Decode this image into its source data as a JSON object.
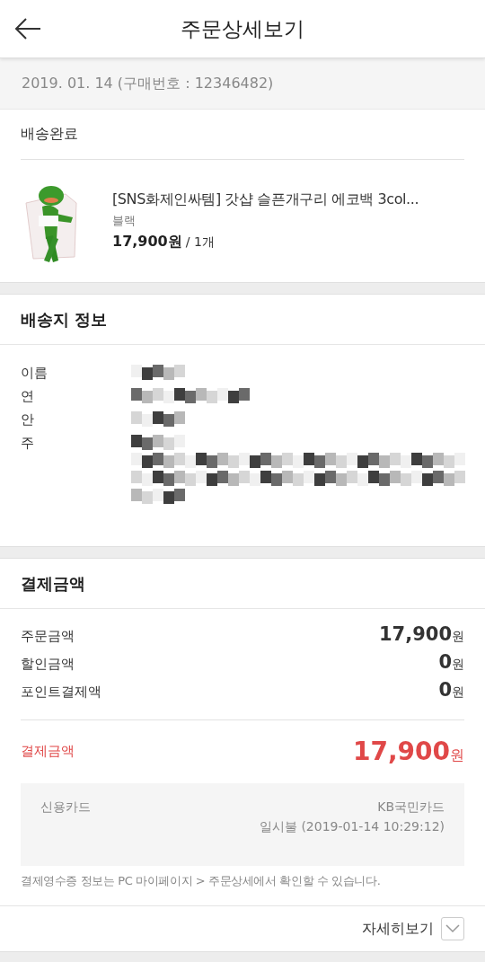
{
  "header": {
    "title": "주문상세보기"
  },
  "order": {
    "date": "2019. 01. 14",
    "number_label": "(구매번호 : 12346482)"
  },
  "shipment": {
    "status": "배송완료",
    "product": {
      "kind": "picture",
      "name": "[SNS화제인싸템] 갓샵 슬픈개구리 에코백 3col...",
      "option": "블랙",
      "price": "17,900원",
      "quantity": "/ 1개"
    }
  },
  "delivery": {
    "title": "배송지 정보",
    "fields": [
      {
        "label": "이름",
        "kind": "single"
      },
      {
        "label": "연",
        "kind": "single"
      },
      {
        "label": "안",
        "kind": "single"
      },
      {
        "label": "주",
        "kind": "address"
      }
    ]
  },
  "payment": {
    "title": "결제금액",
    "rows": [
      {
        "label": "주문금액",
        "amount": "17,900",
        "unit": "원"
      },
      {
        "label": "할인금액",
        "amount": "0",
        "unit": "원"
      },
      {
        "label": "포인트결제액",
        "amount": "0",
        "unit": "원"
      }
    ],
    "total": {
      "label": "결제금액",
      "amount": "17,900",
      "unit": "원"
    },
    "method": {
      "type": "신용카드",
      "card": "KB국민카드",
      "detail": "일시불 (2019-01-14 10:29:12)"
    },
    "notice": "결제영수증 정보는 PC 마이페이지 > 주문상세에서 확인할 수 있습니다.",
    "more": {
      "label": "자세히보기",
      "expanded": false
    }
  }
}
